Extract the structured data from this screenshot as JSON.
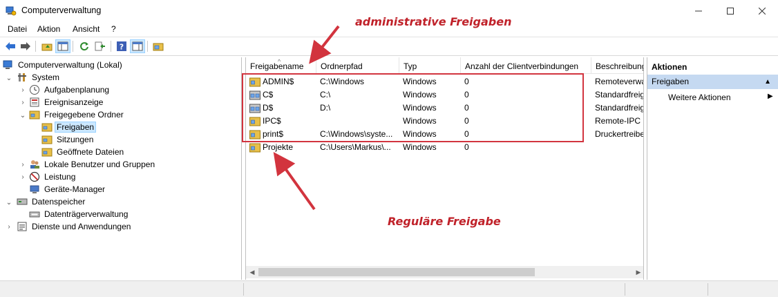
{
  "window": {
    "title": "Computerverwaltung",
    "minimize_icon": "minimize-icon",
    "maximize_icon": "maximize-icon",
    "close_icon": "close-icon"
  },
  "menu": {
    "items": [
      "Datei",
      "Aktion",
      "Ansicht",
      "?"
    ]
  },
  "toolbar": {
    "buttons": [
      "back-arrow-icon",
      "forward-arrow-icon",
      "up-folder-icon",
      "console-tree-icon",
      "refresh-icon",
      "export-list-icon",
      "help-icon",
      "action-pane-icon",
      "share-folder-icon"
    ]
  },
  "tree": {
    "root": "Computerverwaltung (Lokal)",
    "system": "System",
    "aufgabenplanung": "Aufgabenplanung",
    "ereignisanzeige": "Ereignisanzeige",
    "freigegebene_ordner": "Freigegebene Ordner",
    "freigaben": "Freigaben",
    "sitzungen": "Sitzungen",
    "geoeffnete_dateien": "Geöffnete Dateien",
    "lokale_benutzer": "Lokale Benutzer und Gruppen",
    "leistung": "Leistung",
    "geraete_manager": "Geräte-Manager",
    "datenspeicher": "Datenspeicher",
    "datentraegerverwaltung": "Datenträgerverwaltung",
    "dienste": "Dienste und Anwendungen"
  },
  "list": {
    "columns": [
      "Freigabename",
      "Ordnerpfad",
      "Typ",
      "Anzahl der Clientverbindungen",
      "Beschreibung"
    ],
    "rows": [
      {
        "name": "ADMIN$",
        "path": "C:\\Windows",
        "type": "Windows",
        "clients": "0",
        "desc": "Remoteverwa"
      },
      {
        "name": "C$",
        "path": "C:\\",
        "type": "Windows",
        "clients": "0",
        "desc": "Standardfreig"
      },
      {
        "name": "D$",
        "path": "D:\\",
        "type": "Windows",
        "clients": "0",
        "desc": "Standardfreig"
      },
      {
        "name": "IPC$",
        "path": "",
        "type": "Windows",
        "clients": "0",
        "desc": "Remote-IPC"
      },
      {
        "name": "print$",
        "path": "C:\\Windows\\syste...",
        "type": "Windows",
        "clients": "0",
        "desc": "Druckertreibe"
      },
      {
        "name": "Projekte",
        "path": "C:\\Users\\Markus\\...",
        "type": "Windows",
        "clients": "0",
        "desc": ""
      }
    ]
  },
  "actions": {
    "header": "Aktionen",
    "group": "Freigaben",
    "item": "Weitere Aktionen"
  },
  "annotations": {
    "admin_label": "administrative Freigaben",
    "regular_label": "Reguläre Freigabe",
    "color": "#c0222a"
  },
  "colors": {
    "selection": "#cce8ff",
    "action_group": "#c5d9f1"
  }
}
